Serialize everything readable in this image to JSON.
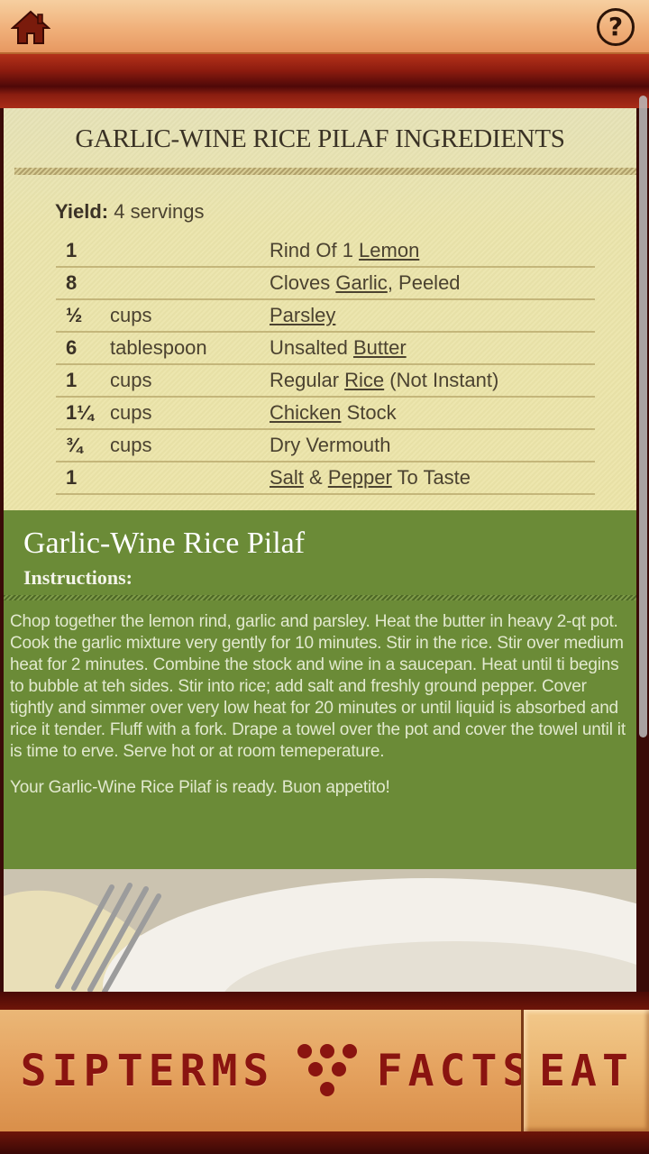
{
  "header": {
    "home_icon": "home-icon",
    "help_label": "?"
  },
  "ingredients": {
    "title": "GARLIC-WINE RICE PILAF INGREDIENTS",
    "yield_label": "Yield:",
    "yield_value": "4 servings",
    "rows": [
      {
        "qty": "1",
        "unit": "",
        "parts": [
          {
            "t": "Rind Of 1 "
          },
          {
            "t": "Lemon",
            "link": true
          }
        ]
      },
      {
        "qty": "8",
        "unit": "",
        "parts": [
          {
            "t": "Cloves "
          },
          {
            "t": "Garlic",
            "link": true
          },
          {
            "t": ", Peeled"
          }
        ]
      },
      {
        "qty": "½",
        "unit": "cups",
        "parts": [
          {
            "t": "Parsley",
            "link": true
          }
        ]
      },
      {
        "qty": "6",
        "unit": "tablespoon",
        "parts": [
          {
            "t": "Unsalted "
          },
          {
            "t": "Butter",
            "link": true
          }
        ]
      },
      {
        "qty": "1",
        "unit": "cups",
        "parts": [
          {
            "t": "Regular "
          },
          {
            "t": "Rice",
            "link": true
          },
          {
            "t": " (Not Instant)"
          }
        ]
      },
      {
        "qty": "1¼",
        "unit": "cups",
        "parts": [
          {
            "t": "Chicken",
            "link": true
          },
          {
            "t": " Stock"
          }
        ]
      },
      {
        "qty": "¾",
        "unit": "cups",
        "parts": [
          {
            "t": "Dry Vermouth"
          }
        ]
      },
      {
        "qty": "1",
        "unit": "",
        "parts": [
          {
            "t": "Salt",
            "link": true
          },
          {
            "t": " & "
          },
          {
            "t": "Pepper",
            "link": true
          },
          {
            "t": " To Taste"
          }
        ]
      }
    ]
  },
  "instructions": {
    "recipe_name": "Garlic-Wine Rice Pilaf",
    "label": "Instructions:",
    "body": "Chop together the lemon rind, garlic and parsley. Heat the butter in heavy 2-qt pot. Cook the garlic mixture very gently for 10 minutes. Stir in the rice. Stir over medium heat for 2 minutes. Combine the stock and wine in a saucepan. Heat until ti begins to bubble at teh sides. Stir into rice; add salt and freshly ground pepper. Cover tightly and simmer over very low heat for 20 minutes or until liquid is absorbed and rice it tender. Fluff with a fork. Drape a towel over the pot and cover the towel until it is time to erve. Serve hot or at room temeperature.",
    "closing": "Your Garlic-Wine Rice Pilaf is ready. Buon appetito!"
  },
  "nav": {
    "sip": "SIP",
    "terms": "TERMS",
    "grapes_icon": "grapes-icon",
    "facts": "FACTS",
    "eat": "EAT",
    "active": "EAT"
  },
  "colors": {
    "instructions_bg": "#6b8b37",
    "ingredients_bg": "#ece4a8",
    "header_band": "#8e1c0f",
    "nav_label": "#8a1410"
  }
}
